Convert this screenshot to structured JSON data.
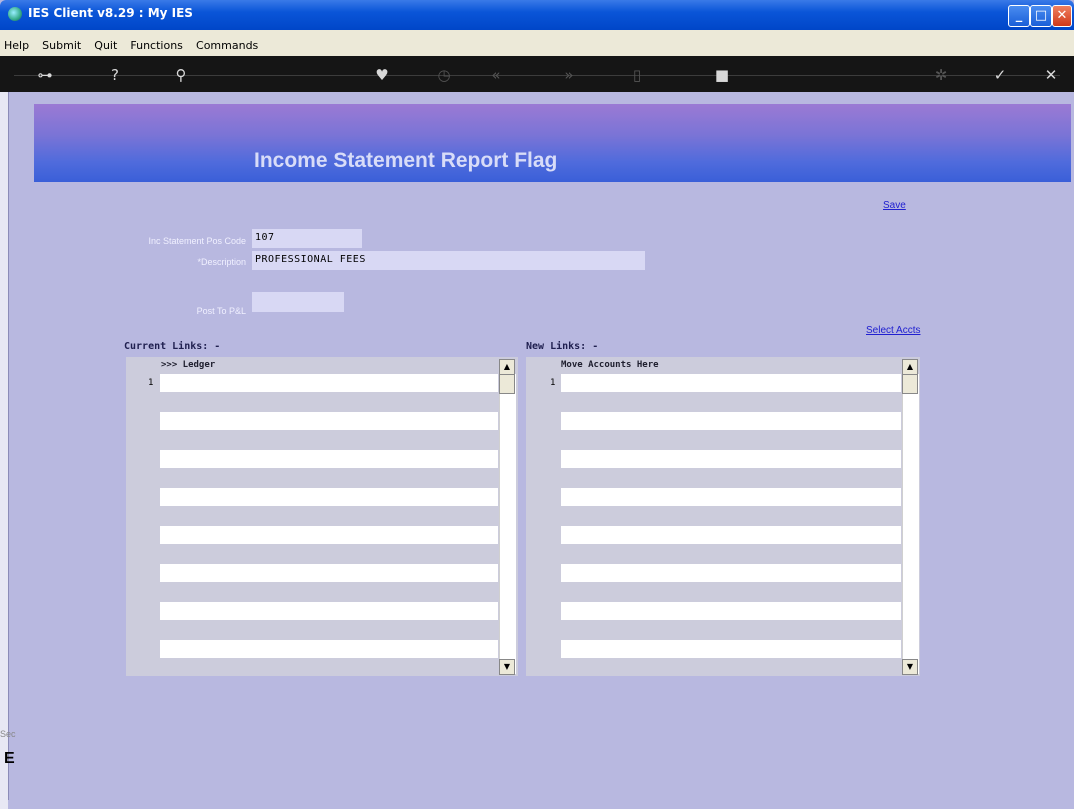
{
  "window": {
    "title": "IES Client v8.29 : My IES"
  },
  "menu": [
    "Help",
    "Submit",
    "Quit",
    "Functions",
    "Commands"
  ],
  "toolbar_icons": [
    "key-icon",
    "help-icon",
    "search-icon",
    "heart-icon",
    "clock-icon",
    "rewind-icon",
    "forward-icon",
    "copy-icon",
    "stop-icon",
    "gear-icon",
    "check-icon",
    "close-icon"
  ],
  "banner": {
    "title": "Income Statement Report Flag"
  },
  "links": {
    "save": "Save",
    "select_accts": "Select Accts"
  },
  "form": {
    "pos_code_label": "Inc Statement Pos Code",
    "pos_code_value": "107",
    "description_label": "*Description",
    "description_value": "PROFESSIONAL FEES",
    "post_label": "Post To P&L",
    "post_value": ""
  },
  "current_links": {
    "title": "Current Links: -",
    "column": ">>> Ledger",
    "row_number": "1"
  },
  "new_links": {
    "title": "New Links: -",
    "column": "Move Accounts Here",
    "row_number": "1"
  },
  "status": {
    "text": "Sec",
    "char": "E"
  }
}
